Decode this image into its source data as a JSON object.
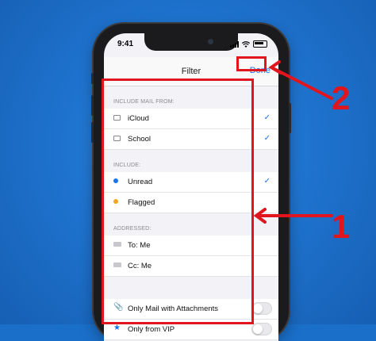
{
  "status_bar": {
    "time": "9:41"
  },
  "navbar": {
    "title": "Filter",
    "done_label": "Done"
  },
  "sections": {
    "include_mail_from": {
      "header": "INCLUDE MAIL FROM:",
      "items": [
        {
          "label": "iCloud",
          "icon": "mail-icon",
          "checked": true
        },
        {
          "label": "School",
          "icon": "mail-icon",
          "checked": true
        }
      ]
    },
    "include": {
      "header": "INCLUDE:",
      "items": [
        {
          "label": "Unread",
          "icon": "unread-dot-icon",
          "color": "#1a73e8",
          "checked": true
        },
        {
          "label": "Flagged",
          "icon": "flag-dot-icon",
          "color": "#f5a623",
          "checked": false
        }
      ]
    },
    "addressed": {
      "header": "ADDRESSED:",
      "items": [
        {
          "label": "To: Me",
          "icon": "to-tag-icon"
        },
        {
          "label": "Cc: Me",
          "icon": "cc-tag-icon"
        }
      ]
    },
    "options": {
      "items": [
        {
          "label": "Only Mail with Attachments",
          "icon": "paperclip-icon",
          "enabled": false
        },
        {
          "label": "Only from VIP",
          "icon": "star-icon",
          "enabled": false
        }
      ]
    }
  },
  "check_glyph": "✓",
  "annotations": {
    "num1": "1",
    "num2": "2",
    "color": "#e0151d"
  },
  "colors": {
    "accent": "#1a73e8",
    "background": "#1a6fc9"
  }
}
